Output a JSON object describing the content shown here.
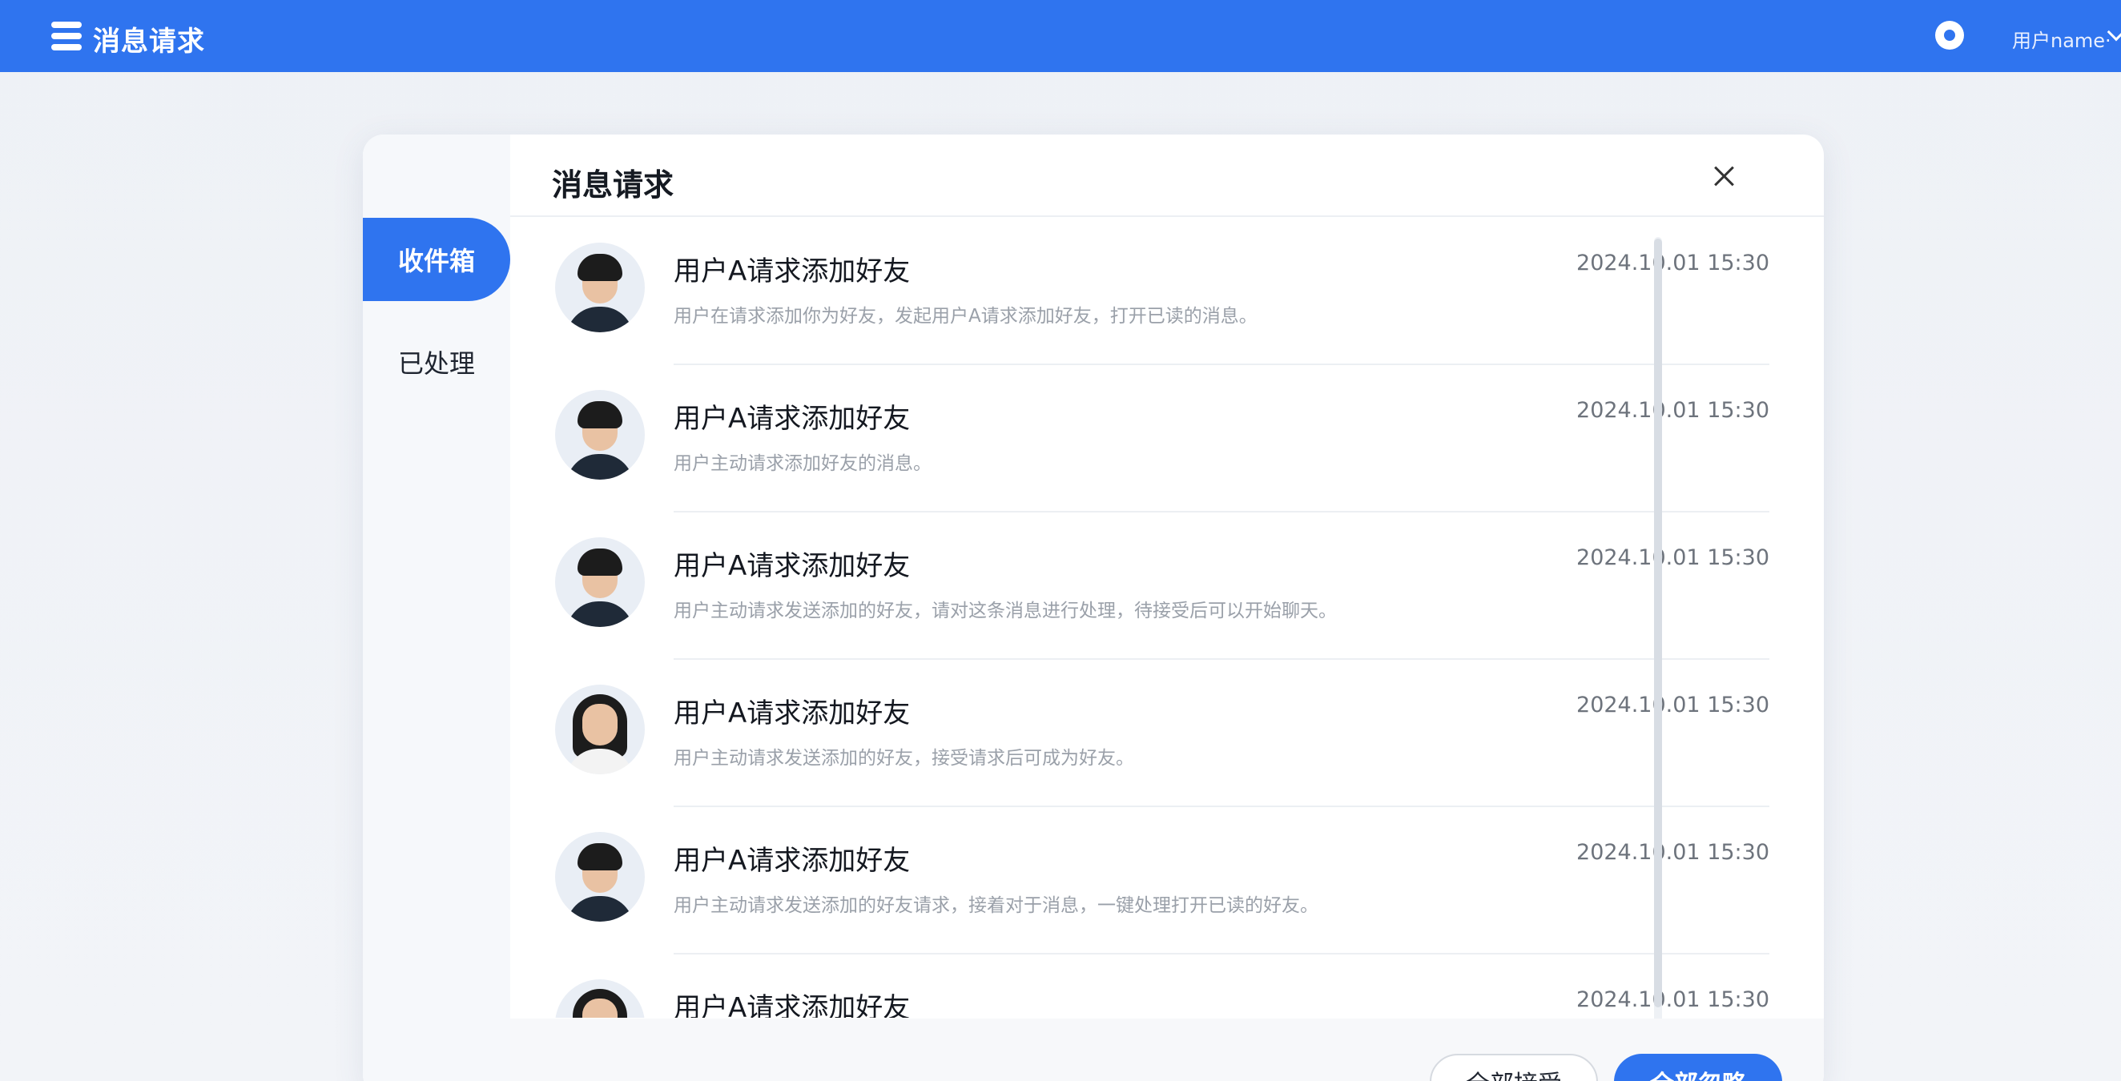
{
  "header": {
    "title": "消息请求",
    "user_name": "用户name·"
  },
  "sidebar": {
    "items": [
      {
        "label": "收件箱",
        "active": true
      },
      {
        "label": "已处理",
        "active": false
      }
    ]
  },
  "dialog": {
    "title": "消息请求"
  },
  "requests": [
    {
      "name": "用户A请求添加好友",
      "time": "2024.10.01 15:30",
      "message": "用户在请求添加你为好友，发起用户A请求添加好友，打开已读的消息。",
      "avatar": "male"
    },
    {
      "name": "用户A请求添加好友",
      "time": "2024.10.01 15:30",
      "message": "用户主动请求添加好友的消息。",
      "avatar": "male"
    },
    {
      "name": "用户A请求添加好友",
      "time": "2024.10.01 15:30",
      "message": "用户主动请求发送添加的好友，请对这条消息进行处理，待接受后可以开始聊天。",
      "avatar": "male"
    },
    {
      "name": "用户A请求添加好友",
      "time": "2024.10.01 15:30",
      "message": "用户主动请求发送添加的好友，接受请求后可成为好友。",
      "avatar": "female"
    },
    {
      "name": "用户A请求添加好友",
      "time": "2024.10.01 15:30",
      "message": "用户主动请求发送添加的好友请求，接着对于消息，一键处理打开已读的好友。",
      "avatar": "male"
    },
    {
      "name": "用户A请求添加好友",
      "time": "2024.10.01 15:30",
      "message": "",
      "avatar": "female"
    }
  ],
  "footer": {
    "accept_all": "全部接受",
    "ignore_all": "全部忽略"
  },
  "colors": {
    "brand": "#2f74ef",
    "background": "#eef1f6"
  },
  "icons": [
    "menu-icon",
    "user-icon",
    "chevron-down-icon",
    "close-icon"
  ]
}
